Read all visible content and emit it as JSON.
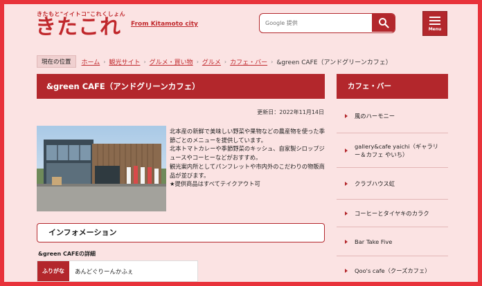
{
  "header": {
    "logo_small": "きたもと\"イイトコ\"これくしょん",
    "logo_big": "きたこれ",
    "tagline": "From Kitamoto city",
    "search_placeholder": "Google 提供",
    "menu_label": "Menu"
  },
  "breadcrumb": {
    "here_label": "現在の位置",
    "items": [
      "ホーム",
      "観光サイト",
      "グルメ・買い物",
      "グルメ",
      "カフェ・バー"
    ],
    "current": "&green CAFE（アンドグリーンカフェ）"
  },
  "main": {
    "title": "&green CAFE（アンドグリーンカフェ）",
    "updated": "更新日：2022年11月14日",
    "description": [
      "北本産の新鮮で美味しい野菜や果物などの農産物を使った季節ごとのメニューを提供しています。",
      "北本トマトカレーや季節野菜のキッシュ、自家製シロップジュースやコーヒーなどがおすすめ。",
      "観光案内所としてパンフレットや市内外のこだわりの物販商品が並びます。",
      "★提供商品はすべてテイクアウト可"
    ],
    "info_heading": "インフォメーション",
    "detail_label": "&green CAFEの詳細",
    "furigana_label": "ふりがな",
    "furigana_value": "あんどぐりーんかふぇ"
  },
  "sidebar": {
    "title": "カフェ・バー",
    "items": [
      "風のハーモニー",
      "gallery&cafe yaichi（ギャラリー＆カフェ やいち）",
      "クラブハウス虹",
      "コーヒーとタイヤキのカラク",
      "Bar Take Five",
      "Qoo's cafe（クーズカフェ）"
    ]
  },
  "colors": {
    "primary": "#b3272c",
    "background": "#fbe3e3",
    "frame": "#e8323a"
  }
}
